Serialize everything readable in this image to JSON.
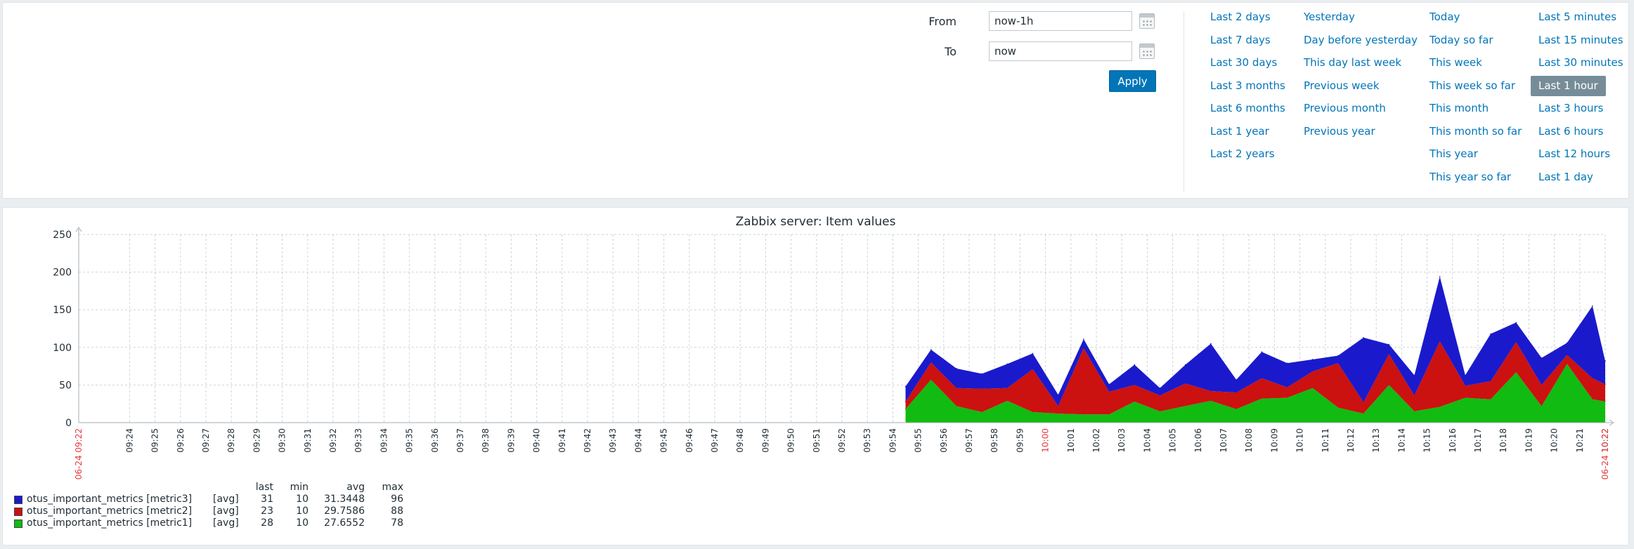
{
  "filter": {
    "from_label": "From",
    "from_value": "now-1h",
    "to_label": "To",
    "to_value": "now",
    "apply_label": "Apply"
  },
  "quick_ranges": [
    [
      "Last 2 days",
      "Last 7 days",
      "Last 30 days",
      "Last 3 months",
      "Last 6 months",
      "Last 1 year",
      "Last 2 years"
    ],
    [
      "Yesterday",
      "Day before yesterday",
      "This day last week",
      "Previous week",
      "Previous month",
      "Previous year"
    ],
    [
      "Today",
      "Today so far",
      "This week",
      "This week so far",
      "This month",
      "This month so far",
      "This year",
      "This year so far"
    ],
    [
      "Last 5 minutes",
      "Last 15 minutes",
      "Last 30 minutes",
      "Last 1 hour",
      "Last 3 hours",
      "Last 6 hours",
      "Last 12 hours",
      "Last 1 day"
    ]
  ],
  "selected_range": "Last 1 hour",
  "graph": {
    "title": "Zabbix server: Item values",
    "legend_headers": [
      "last",
      "min",
      "avg",
      "max"
    ],
    "legend": [
      {
        "name": "otus_important_metrics [metric3]",
        "func": "[avg]",
        "last": "31",
        "min": "10",
        "avg": "31.3448",
        "max": "96",
        "color": "#1a1acc"
      },
      {
        "name": "otus_important_metrics [metric2]",
        "func": "[avg]",
        "last": "23",
        "min": "10",
        "avg": "29.7586",
        "max": "88",
        "color": "#cc1111"
      },
      {
        "name": "otus_important_metrics [metric1]",
        "func": "[avg]",
        "last": "28",
        "min": "10",
        "avg": "27.6552",
        "max": "78",
        "color": "#11bb11"
      }
    ]
  },
  "chart_data": {
    "type": "area",
    "stacked": true,
    "title": "Zabbix server: Item values",
    "ylim": [
      0,
      250
    ],
    "yticks": [
      0,
      50,
      100,
      150,
      200,
      250
    ],
    "grid": true,
    "start_label": "06-24 09:22",
    "end_label": "06-24 10:22",
    "x_ticks": [
      "09:24",
      "09:25",
      "09:26",
      "09:27",
      "09:28",
      "09:29",
      "09:30",
      "09:31",
      "09:32",
      "09:33",
      "09:34",
      "09:35",
      "09:36",
      "09:37",
      "09:38",
      "09:39",
      "09:40",
      "09:41",
      "09:42",
      "09:43",
      "09:44",
      "09:45",
      "09:46",
      "09:47",
      "09:48",
      "09:49",
      "09:50",
      "09:51",
      "09:52",
      "09:53",
      "09:54",
      "09:55",
      "09:56",
      "09:57",
      "09:58",
      "09:59",
      "10:00",
      "10:01",
      "10:02",
      "10:03",
      "10:04",
      "10:05",
      "10:06",
      "10:07",
      "10:08",
      "10:09",
      "10:10",
      "10:11",
      "10:12",
      "10:13",
      "10:14",
      "10:15",
      "10:16",
      "10:17",
      "10:18",
      "10:19",
      "10:20",
      "10:21",
      "10:22"
    ],
    "highlight_ticks": [
      "10:00"
    ],
    "x": [
      "09:54:30",
      "09:55:30",
      "09:56:30",
      "09:57:30",
      "09:58:30",
      "09:59:30",
      "10:00:30",
      "10:01:30",
      "10:02:30",
      "10:03:30",
      "10:04:30",
      "10:05:30",
      "10:06:30",
      "10:07:30",
      "10:08:30",
      "10:09:30",
      "10:10:30",
      "10:11:30",
      "10:12:30",
      "10:13:30",
      "10:14:30",
      "10:15:30",
      "10:16:30",
      "10:17:30",
      "10:18:30",
      "10:19:30",
      "10:20:30",
      "10:21:30",
      "10:22:00"
    ],
    "series": [
      {
        "name": "otus_important_metrics [metric1]",
        "color": "#11bb11",
        "values": [
          18,
          57,
          22,
          14,
          29,
          14,
          12,
          11,
          11,
          28,
          15,
          22,
          29,
          18,
          32,
          33,
          46,
          20,
          12,
          50,
          15,
          21,
          33,
          31,
          67,
          22,
          78,
          31,
          28
        ]
      },
      {
        "name": "otus_important_metrics [metric2]",
        "color": "#cc1111",
        "values": [
          10,
          23,
          24,
          31,
          17,
          57,
          10,
          88,
          30,
          22,
          21,
          30,
          13,
          22,
          27,
          14,
          22,
          59,
          15,
          41,
          21,
          87,
          16,
          24,
          40,
          28,
          12,
          28,
          23
        ]
      },
      {
        "name": "otus_important_metrics [metric3]",
        "color": "#1a1acc",
        "values": [
          20,
          17,
          26,
          20,
          32,
          21,
          15,
          12,
          10,
          27,
          10,
          25,
          63,
          17,
          35,
          32,
          16,
          10,
          86,
          13,
          27,
          86,
          14,
          63,
          26,
          36,
          16,
          96,
          31
        ]
      }
    ]
  }
}
